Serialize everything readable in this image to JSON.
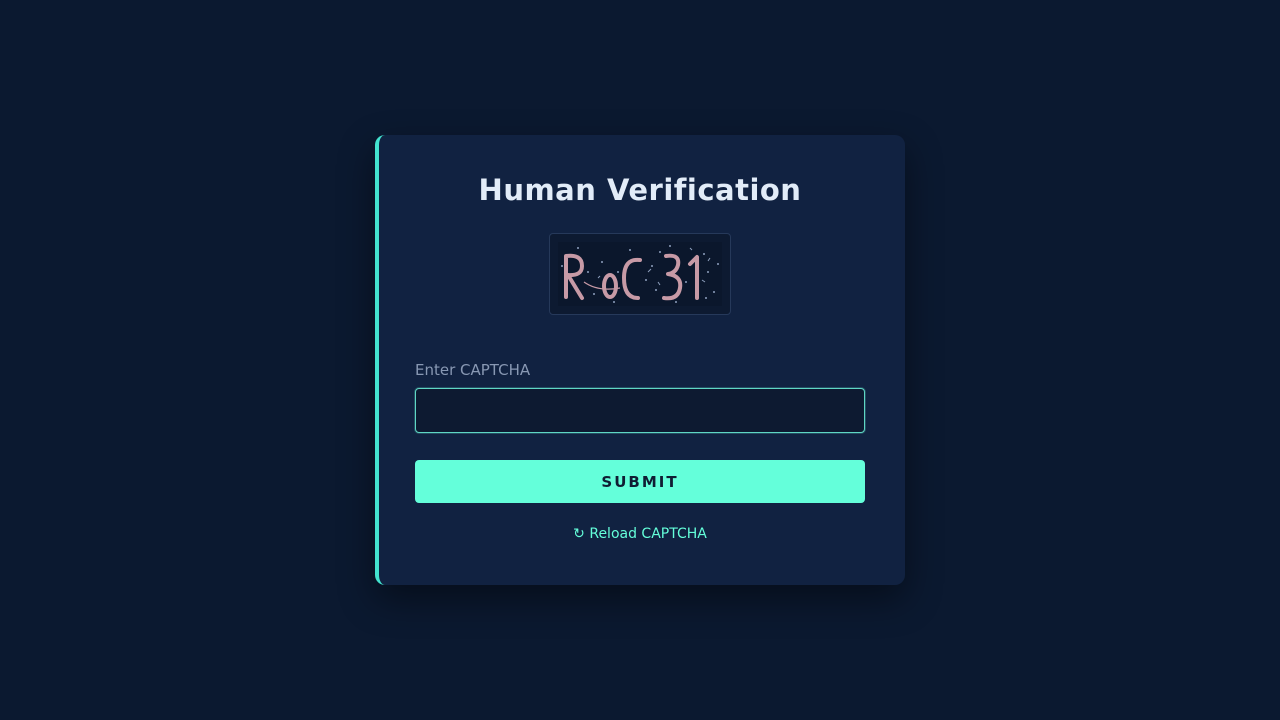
{
  "card": {
    "title": "Human Verification",
    "accent_color": "#43e3d0"
  },
  "captcha": {
    "text": "ROC31",
    "text_color": "#c79aa6"
  },
  "form": {
    "label": "Enter CAPTCHA",
    "input_value": "",
    "submit_label": "SUBMIT"
  },
  "reload": {
    "icon": "↻",
    "label": "Reload CAPTCHA"
  },
  "colors": {
    "background": "#0b1930",
    "card": "#112241",
    "button": "#64ffda"
  }
}
